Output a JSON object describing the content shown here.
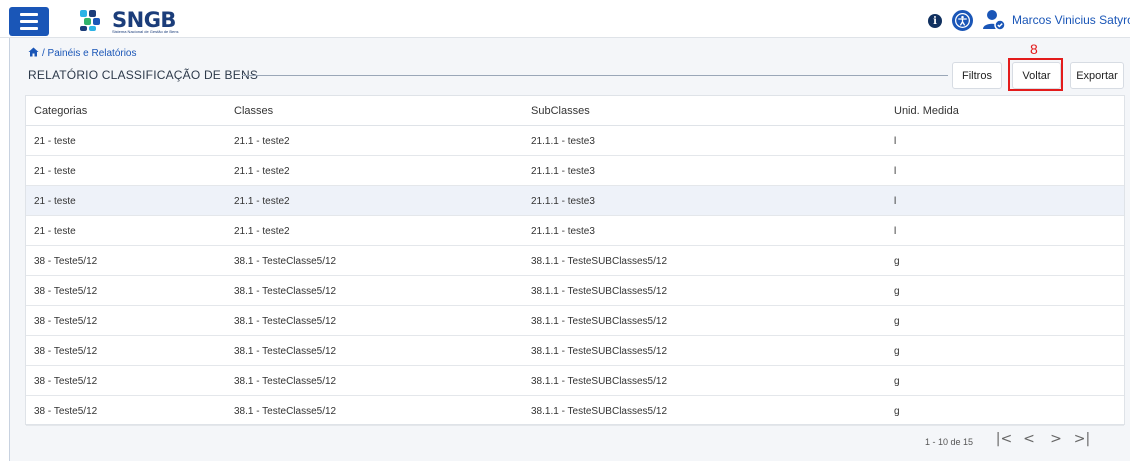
{
  "header": {
    "logo_text": "SNGB",
    "logo_subtitle": "Sistema Nacional de Gestão de Bens",
    "user_name": "Marcos Vinicius Satyro C..."
  },
  "breadcrumb": {
    "text": "/ Painéis e Relatórios"
  },
  "page": {
    "title": "RELATÓRIO CLASSIFICAÇÃO DE BENS"
  },
  "toolbar": {
    "filtros_label": "Filtros",
    "voltar_label": "Voltar",
    "exportar_label": "Exportar"
  },
  "annotation": {
    "number": "8"
  },
  "table": {
    "headers": [
      "Categorias",
      "Classes",
      "SubClasses",
      "Unid. Medida"
    ],
    "rows": [
      [
        "21 - teste",
        "21.1 - teste2",
        "21.1.1 - teste3",
        "l"
      ],
      [
        "21 - teste",
        "21.1 - teste2",
        "21.1.1 - teste3",
        "l"
      ],
      [
        "21 - teste",
        "21.1 - teste2",
        "21.1.1 - teste3",
        "l"
      ],
      [
        "21 - teste",
        "21.1 - teste2",
        "21.1.1 - teste3",
        "l"
      ],
      [
        "38 - Teste5/12",
        "38.1 - TesteClasse5/12",
        "38.1.1 - TesteSUBClasses5/12",
        "g"
      ],
      [
        "38 - Teste5/12",
        "38.1 - TesteClasse5/12",
        "38.1.1 - TesteSUBClasses5/12",
        "g"
      ],
      [
        "38 - Teste5/12",
        "38.1 - TesteClasse5/12",
        "38.1.1 - TesteSUBClasses5/12",
        "g"
      ],
      [
        "38 - Teste5/12",
        "38.1 - TesteClasse5/12",
        "38.1.1 - TesteSUBClasses5/12",
        "g"
      ],
      [
        "38 - Teste5/12",
        "38.1 - TesteClasse5/12",
        "38.1.1 - TesteSUBClasses5/12",
        "g"
      ],
      [
        "38 - Teste5/12",
        "38.1 - TesteClasse5/12",
        "38.1.1 - TesteSUBClasses5/12",
        "g"
      ]
    ],
    "highlighted_row": 2
  },
  "pagination": {
    "info": "1 - 10 de 15",
    "first_icon": "|<",
    "prev_icon": "<",
    "next_icon": ">",
    "last_icon": ">|"
  },
  "colors": {
    "primary": "#1a56b7",
    "annotation": "#e31b1b",
    "content_bg": "#f4f6f9"
  }
}
